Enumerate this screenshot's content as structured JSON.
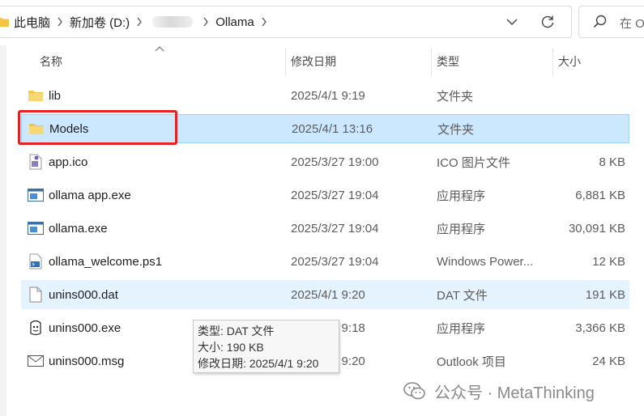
{
  "address_bar": {
    "crumbs": [
      "此电脑",
      "新加卷 (D:)",
      "Ollama"
    ]
  },
  "search": {
    "placeholder": "在 O"
  },
  "columns": {
    "name": "名称",
    "date": "修改日期",
    "type": "类型",
    "size": "大小"
  },
  "files": [
    {
      "name": "lib",
      "date": "2025/4/1 9:19",
      "type": "文件夹",
      "size": "",
      "icon": "folder-icon"
    },
    {
      "name": "Models",
      "date": "2025/4/1 13:16",
      "type": "文件夹",
      "size": "",
      "icon": "folder-icon"
    },
    {
      "name": "app.ico",
      "date": "2025/3/27 19:00",
      "type": "ICO 图片文件",
      "size": "8 KB",
      "icon": "ico-file-icon"
    },
    {
      "name": "ollama app.exe",
      "date": "2025/3/27 19:04",
      "type": "应用程序",
      "size": "6,881 KB",
      "icon": "exe-icon"
    },
    {
      "name": "ollama.exe",
      "date": "2025/3/27 19:04",
      "type": "应用程序",
      "size": "30,091 KB",
      "icon": "exe-icon"
    },
    {
      "name": "ollama_welcome.ps1",
      "date": "2025/3/27 19:04",
      "type": "Windows Power...",
      "size": "12 KB",
      "icon": "powershell-script-icon"
    },
    {
      "name": "unins000.dat",
      "date": "2025/4/1 9:20",
      "type": "DAT 文件",
      "size": "191 KB",
      "icon": "blank-file-icon"
    },
    {
      "name": "unins000.exe",
      "date": "2025/4/1 9:18",
      "type": "应用程序",
      "size": "3,366 KB",
      "icon": "installer-icon"
    },
    {
      "name": "unins000.msg",
      "date": "2025/4/1 9:20",
      "type": "Outlook 项目",
      "size": "24 KB",
      "icon": "mail-icon"
    }
  ],
  "tooltip": {
    "line1": "类型: DAT 文件",
    "line2": "大小: 190 KB",
    "line3": "修改日期: 2025/4/1 9:20"
  },
  "watermark": {
    "text": "公众号 · MetaThinking"
  },
  "colors": {
    "selection": "#cce8ff",
    "hover": "#e5f3ff",
    "highlight_box": "#e52222",
    "folder": "#f4c542"
  }
}
